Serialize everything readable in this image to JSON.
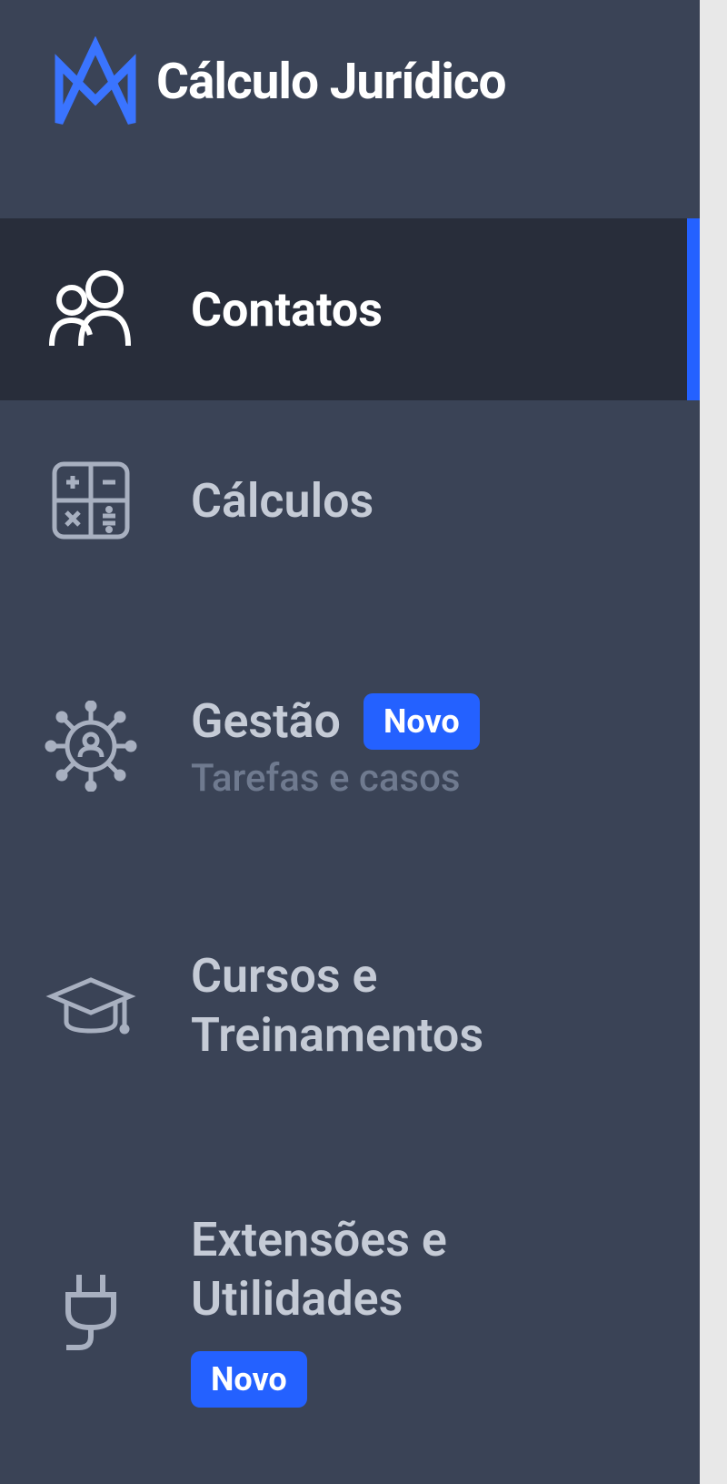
{
  "app": {
    "name": "Cálculo Jurídico"
  },
  "nav": {
    "items": [
      {
        "label": "Contatos",
        "active": true
      },
      {
        "label": "Cálculos",
        "active": false
      },
      {
        "label": "Gestão",
        "sublabel": "Tarefas e casos",
        "badge": "Novo",
        "active": false
      },
      {
        "label": "Cursos e Treinamentos",
        "active": false
      },
      {
        "label": "Extensões e Utilidades",
        "badge": "Novo",
        "active": false
      }
    ]
  }
}
